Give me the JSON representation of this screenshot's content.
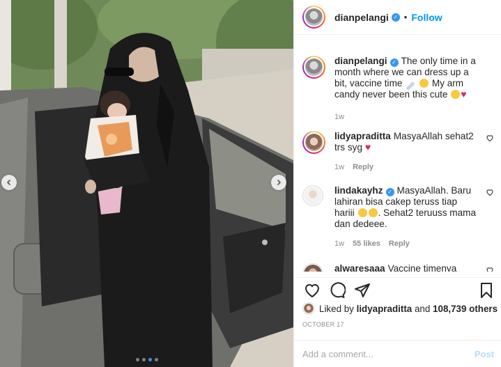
{
  "author": {
    "username": "dianpelangi",
    "follow_label": "Follow",
    "separator": "•"
  },
  "caption": {
    "username": "dianpelangi",
    "text_part1": "The only time in a month where we can dress up a bit, vaccine time",
    "text_part2": "My arm candy never been this cute",
    "age": "1w"
  },
  "comments": [
    {
      "username": "lidyapraditta",
      "text": "MasyaAllah sehat2 trs syg",
      "age": "1w",
      "likes": "",
      "reply_label": "Reply"
    },
    {
      "username": "lindakayhz",
      "text_part1": "MasyaAllah. Baru lahiran bisa cakep teruss tiap hariii",
      "text_part2": ". Sehat2 teruuss mama dan dedeee.",
      "age": "1w",
      "likes": "55 likes",
      "reply_label": "Reply"
    },
    {
      "username": "alwaresaaa",
      "text": "Vaccine timenya",
      "age": "",
      "likes": "",
      "reply_label": ""
    }
  ],
  "likes": {
    "prefix": "Liked by",
    "user": "lidyapraditta",
    "and": "and",
    "count": "108,739 others"
  },
  "date": "OCTOBER 17",
  "add_comment": {
    "placeholder": "Add a comment...",
    "post_label": "Post"
  },
  "carousel": {
    "dot_count": 4,
    "active_index": 2
  },
  "icons": {
    "verified": "verified-badge-icon",
    "like": "heart-icon",
    "comment": "comment-bubble-icon",
    "share": "paper-plane-icon",
    "save": "bookmark-icon"
  },
  "colors": {
    "link_blue": "#0095f6",
    "verified_blue": "#3897f0",
    "muted": "#8e8e8e",
    "post_disabled": "#b2dffc"
  }
}
